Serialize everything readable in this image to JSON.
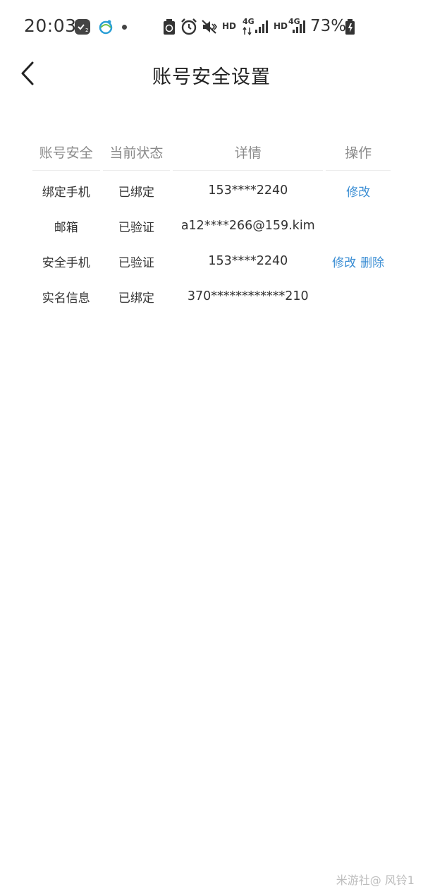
{
  "status_bar": {
    "time": "20:03",
    "network_labels": [
      "HD",
      "4G",
      "HD",
      "4G"
    ],
    "battery_percent": "73%",
    "icons": [
      "tasks-icon",
      "mobile-network-icon",
      "dot-icon",
      "battery-saver-icon",
      "alarm-icon",
      "mute-icon",
      "signal-icon",
      "signal-icon",
      "charging-battery-icon"
    ]
  },
  "header": {
    "title": "账号安全设置",
    "back_icon": "chevron-left-icon"
  },
  "table": {
    "headers": [
      "账号安全",
      "当前状态",
      "详情",
      "操作"
    ],
    "rows": [
      {
        "item": "绑定手机",
        "status": "已绑定",
        "detail": "153****2240",
        "actions": [
          "修改"
        ]
      },
      {
        "item": "邮箱",
        "status": "已验证",
        "detail": "a12****266@159.kim",
        "actions": []
      },
      {
        "item": "安全手机",
        "status": "已验证",
        "detail": "153****2240",
        "actions": [
          "修改",
          "删除"
        ]
      },
      {
        "item": "实名信息",
        "status": "已绑定",
        "detail": "370************210",
        "actions": []
      }
    ]
  },
  "watermark": "米游社@ 风铃1",
  "colors": {
    "link": "#3b8ed4",
    "header_text": "#8a8a8a",
    "body_text": "#333333",
    "background": "#ffffff"
  }
}
